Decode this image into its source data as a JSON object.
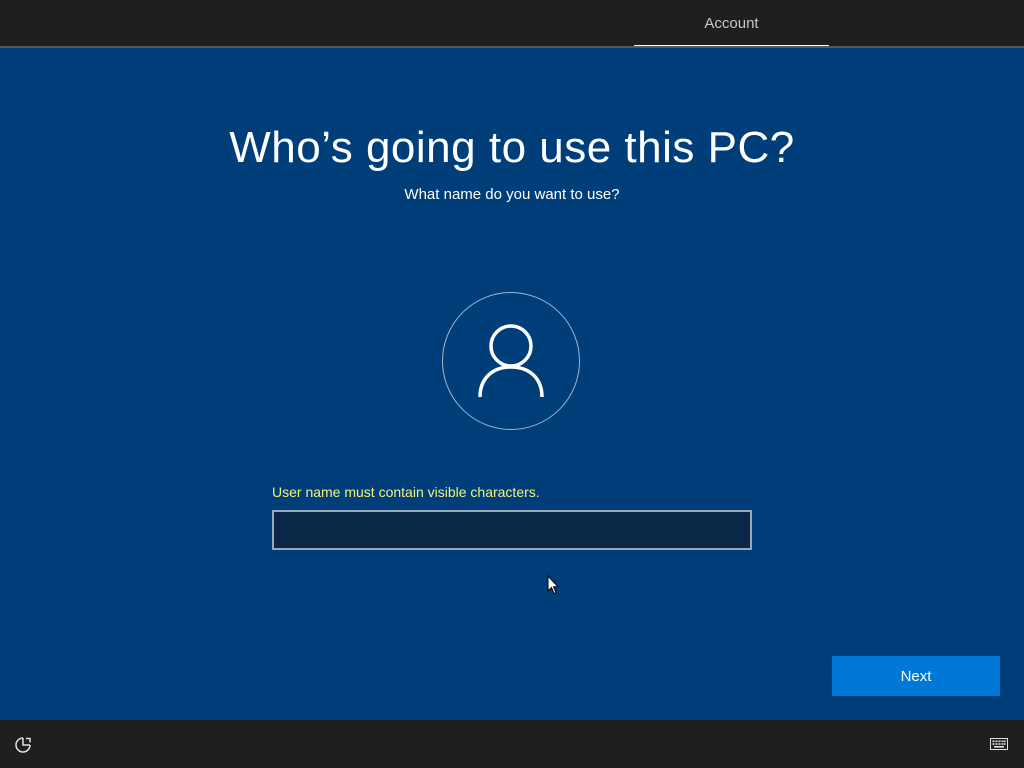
{
  "header": {
    "tabs": [
      {
        "label": "Account",
        "active": true
      }
    ]
  },
  "main": {
    "title": "Who’s going to use this PC?",
    "subtitle": "What name do you want to use?",
    "avatar_icon": "user-icon",
    "error_message": "User name must contain visible characters.",
    "username_input": {
      "value": "",
      "placeholder": ""
    },
    "next_label": "Next"
  },
  "footer": {
    "left_icon": "ease-of-access-icon",
    "right_icon": "keyboard-icon"
  },
  "colors": {
    "background": "#003e7a",
    "bar": "#1f1f1f",
    "accent": "#0078d7",
    "error": "#f2f27a"
  }
}
